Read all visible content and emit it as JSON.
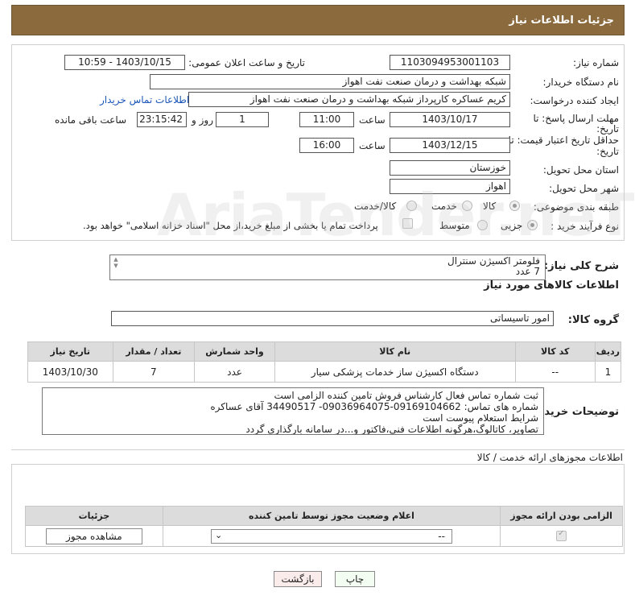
{
  "header": {
    "title": "جزئیات اطلاعات نیاز"
  },
  "form": {
    "need_number": {
      "label": "شماره نیاز:",
      "value": "1103094953001103"
    },
    "announce": {
      "label": "تاریخ و ساعت اعلان عمومی:",
      "value": "1403/10/15 - 10:59"
    },
    "buyer_org": {
      "label": "نام دستگاه خریدار:",
      "value": "شبکه بهداشت و درمان صنعت نفت اهواز"
    },
    "requester": {
      "label": "ایجاد کننده درخواست:",
      "value": "کریم عساکره کارپرداز شبکه بهداشت و درمان صنعت نفت اهواز",
      "contact_link": "اطلاعات تماس خریدار"
    },
    "reply_deadline": {
      "label_1": "مهلت ارسال پاسخ: تا",
      "label_2": "تاریخ:",
      "date": "1403/10/17",
      "time_label": "ساعت",
      "time": "11:00",
      "days": "1",
      "days_label": "روز و",
      "remaining": "23:15:42",
      "remaining_label": "ساعت باقی مانده"
    },
    "price_validity": {
      "label_1": "حداقل تاریخ اعتبار قیمت: تا",
      "label_2": "تاریخ:",
      "date": "1403/12/15",
      "time_label": "ساعت",
      "time": "16:00"
    },
    "province": {
      "label": "استان محل تحویل:",
      "value": "خوزستان"
    },
    "city": {
      "label": "شهر محل تحویل:",
      "value": "اهواز"
    },
    "category": {
      "label": "طبقه بندی موضوعی:",
      "options": [
        "کالا",
        "خدمت",
        "کالا/خدمت"
      ],
      "selected": "کالا"
    },
    "purchase_process": {
      "label": "نوع فرآیند خرید :",
      "options": [
        "جزیی",
        "متوسط"
      ],
      "selected": "جزیی",
      "note": "پرداخت تمام یا بخشی از مبلغ خرید،از محل \"اسناد خزانه اسلامی\" خواهد بود."
    }
  },
  "general_desc": {
    "label": "شرح کلی نیاز:",
    "line1": "فلومتر اکسیژن سنترال",
    "line2": "7 عدد"
  },
  "goods_info": {
    "title": "اطلاعات کالاهای مورد نیاز"
  },
  "goods_group": {
    "label": "گروه کالا:",
    "value": "امور تاسیساتی"
  },
  "goods_table": {
    "headers": [
      "ردیف",
      "کد کالا",
      "نام کالا",
      "واحد شمارش",
      "تعداد / مقدار",
      "تاریخ نیاز"
    ],
    "rows": [
      [
        "1",
        "--",
        "دستگاه اکسیژن ساز خدمات پزشکی سیار",
        "عدد",
        "7",
        "1403/10/30"
      ]
    ]
  },
  "buyer_notes": {
    "label": "توضیحات خریدار:",
    "lines": [
      "ثبت شماره تماس فعال کارشناس فروش تامین کننده الزامی است",
      "شماره های تماس: 09169104662-09036964075- 34490517 آقای عساکره",
      "شرایط استعلام پیوست است",
      "تصاویر، کاتالوگ،هرگونه اطلاعات فنی،فاکتور و...در سامانه بارگذاری گردد"
    ]
  },
  "permits": {
    "title": "اطلاعات مجوزهای ارائه خدمت / کالا",
    "headers": [
      "الزامی بودن ارائه مجوز",
      "اعلام وضعیت مجوز توسط تامین کننده",
      "جزئیات"
    ],
    "select_value": "--",
    "view_button": "مشاهده مجوز"
  },
  "actions": {
    "print": "چاپ",
    "back": "بازگشت"
  },
  "watermark": "AriaTender.neT"
}
